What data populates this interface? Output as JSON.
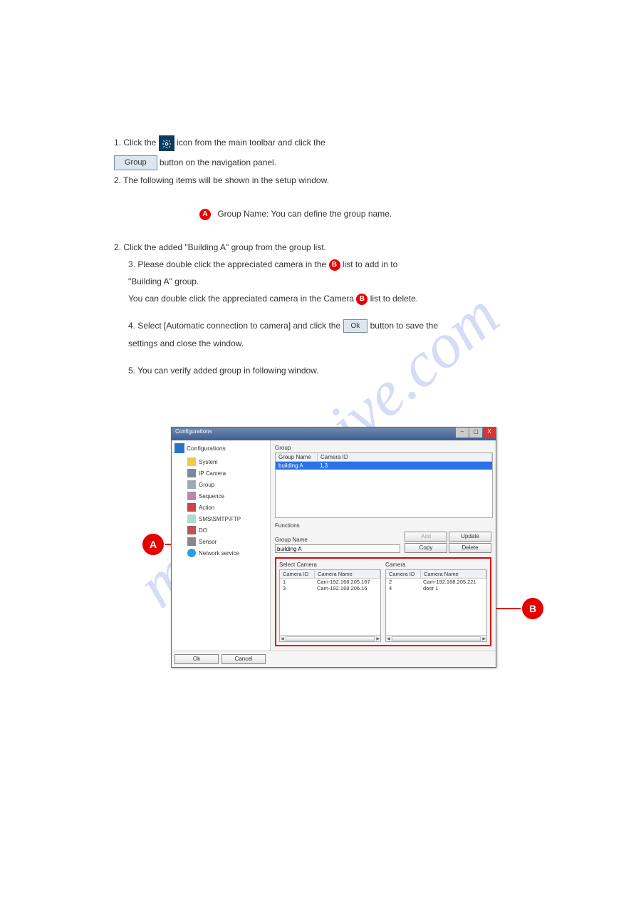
{
  "watermark": "manualshive.com",
  "intro": {
    "line1_pre": "1. Click the ",
    "line1_post": " icon from the main toolbar and click the",
    "btn1": "Group",
    "line2": " button on the navigation panel.",
    "line3": "2. The following items will be shown in the setup window."
  },
  "calloutA": "A",
  "calloutB": "B",
  "sectionA": {
    "title": "Group Name: You can define the group name.",
    "num2": "2. Click the added \"Building A\" group from the group list.",
    "num3_pre": "3. Please double click the appreciated camera in the ",
    "num3_post": " list to add in to",
    "num3_line2": "\"Building A\" group.",
    "num3_line3_pre": "You can double click the appreciated camera in the Camera ",
    "num3_line3_post": " list to delete.",
    "num4_pre": "4. Select [Automatic connection to camera] and click the ",
    "num4_btn": "Ok",
    "num4_post": " button to save the",
    "num4_line2": "settings and close the window.",
    "num5": "5. You can verify added group in following window."
  },
  "window": {
    "title": "Configurations",
    "tree_root": "Configurations",
    "tree": {
      "system": "System",
      "ipcamera": "IP Camera",
      "group": "Group",
      "sequence": "Sequence",
      "action": "Action",
      "sms": "SMS\\SMTP\\FTP",
      "do": "DO",
      "sensor": "Sensor",
      "network": "Network service"
    },
    "group_section": "Group",
    "group_cols": {
      "name": "Group Name",
      "cid": "Camera ID"
    },
    "group_row": {
      "name": "building A",
      "cid": "1,3"
    },
    "functions_label": "Functions",
    "group_name_label": "Group Name",
    "group_name_val": "building A",
    "buttons": {
      "add": "Add",
      "update": "Update",
      "copy": "Copy",
      "delete": "Delete"
    },
    "select_camera_label": "Select Camera",
    "camera_label": "Camera",
    "cam_cols": {
      "id": "Camera ID",
      "name": "Camera Name"
    },
    "select_rows": [
      {
        "id": "1",
        "name": "Cam-192.168.205.167"
      },
      {
        "id": "3",
        "name": "Cam-192.168.206.16"
      }
    ],
    "camera_rows": [
      {
        "id": "2",
        "name": "Cam-192.168.205.221"
      },
      {
        "id": "4",
        "name": "door 1"
      }
    ],
    "ok": "Ok",
    "cancel": "Cancel"
  }
}
